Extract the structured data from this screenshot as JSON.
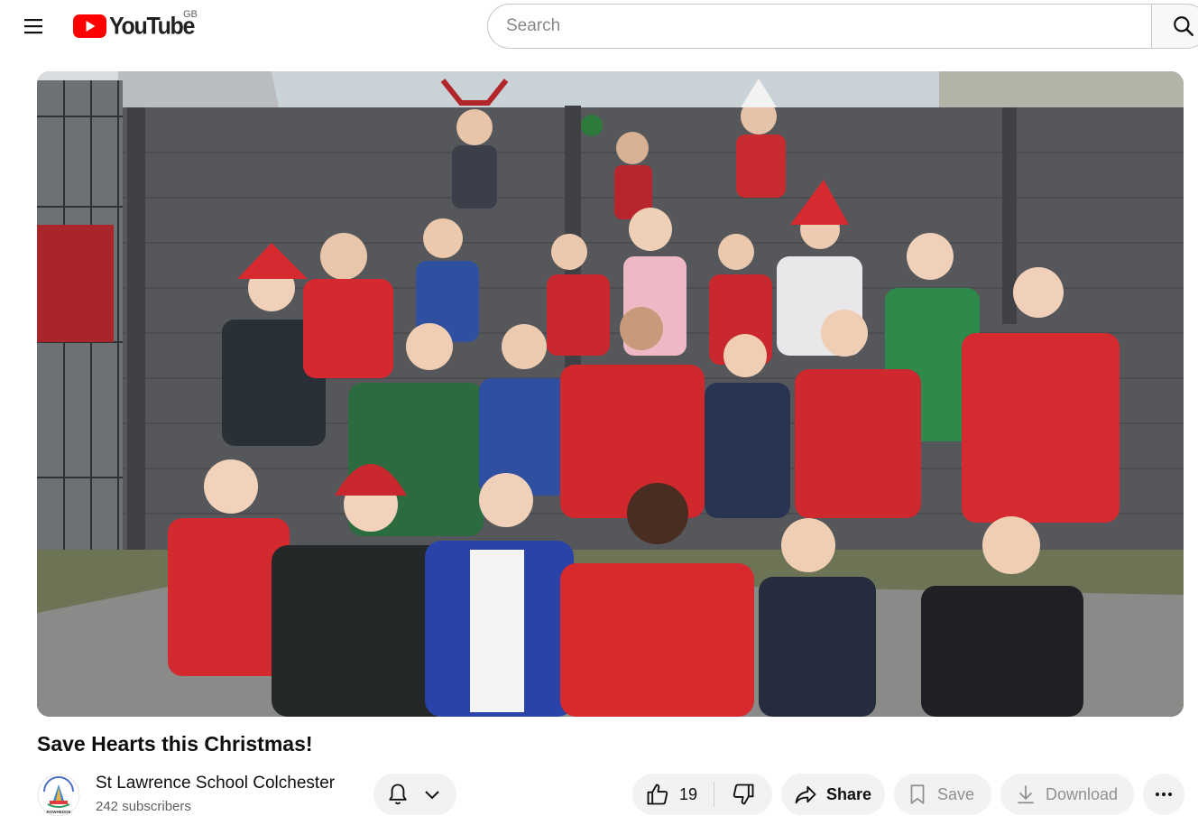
{
  "masthead": {
    "logo_text": "YouTube",
    "country_code": "GB",
    "search_placeholder": "Search"
  },
  "video": {
    "title": "Save Hearts this Christmas!"
  },
  "channel": {
    "name": "St Lawrence School Colchester",
    "subscribers": "242 subscribers",
    "avatar_text": "ROWHEDGE"
  },
  "actions": {
    "likes": "19",
    "share_label": "Share",
    "save_label": "Save",
    "download_label": "Download"
  },
  "colors": {
    "brand_red": "#ff0000",
    "pill_bg": "#f2f2f2",
    "text_primary": "#0f0f0f",
    "text_secondary": "#606060"
  },
  "icons": [
    "menu-icon",
    "youtube-logo-icon",
    "search-icon",
    "bell-icon",
    "chevron-down-icon",
    "thumbs-up-icon",
    "thumbs-down-icon",
    "share-icon",
    "bookmark-icon",
    "download-icon",
    "more-horizontal-icon"
  ]
}
